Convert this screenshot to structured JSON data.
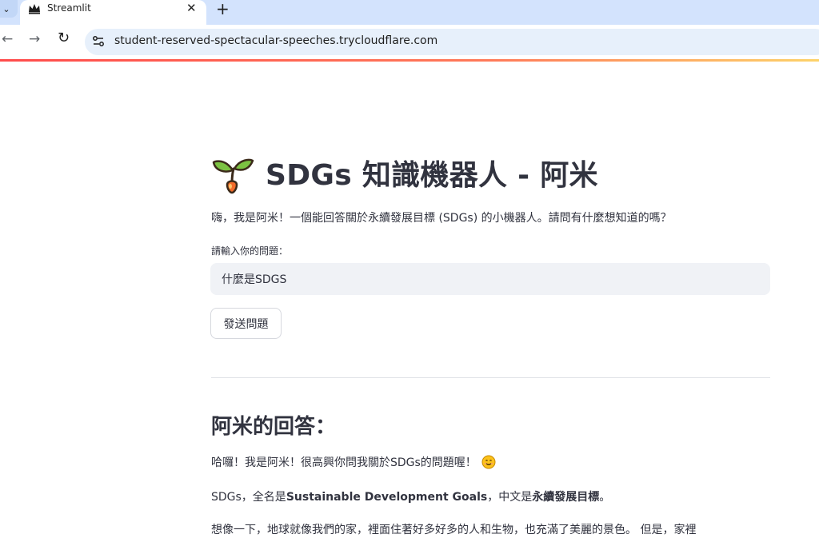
{
  "browser": {
    "tab_title": "Streamlit",
    "url": "student-reserved-spectacular-speeches.trycloudflare.com",
    "icons": {
      "tab_menu": "chevron-down-icon",
      "favicon": "streamlit-crown-icon",
      "close": "close-icon",
      "new_tab": "plus-icon",
      "back": "back-arrow-icon",
      "forward": "forward-arrow-icon",
      "reload": "reload-icon",
      "site_info": "site-settings-icon"
    },
    "glyphs": {
      "tab_menu": "⌄",
      "close": "✕",
      "new_tab": "+",
      "back": "←",
      "forward": "→",
      "reload": "↻"
    }
  },
  "app": {
    "title_icon": "sprout-icon",
    "title": "SDGs 知識機器人 - 阿米",
    "intro": "嗨，我是阿米！一個能回答關於永續發展目標 (SDGs) 的小機器人。請問有什麼想知道的嗎？",
    "input_label": "請輸入你的問題：",
    "input_value": "什麼是SDGS",
    "send_button": "發送問題",
    "answer_heading": "阿米的回答：",
    "answer": {
      "line1": "哈囉！我是阿米！很高興你問我關於SDGs的問題喔！",
      "line1_emoji": "smiling-face-icon",
      "line2_prefix": "SDGs，全名是",
      "line2_bold1": "Sustainable Development Goals",
      "line2_middle": "，中文是",
      "line2_bold2": "永續發展目標",
      "line2_suffix": "。",
      "line3": "想像一下，地球就像我們的家，裡面住著好多好多的人和生物，也充滿了美麗的景色。 但是，家裡"
    }
  },
  "colors": {
    "tabbar": "#d3e3fd",
    "loading_gradient_start": "#ff4b4b",
    "loading_gradient_end": "#fdd36a",
    "text": "#31333f",
    "input_bg": "#f0f2f6"
  }
}
